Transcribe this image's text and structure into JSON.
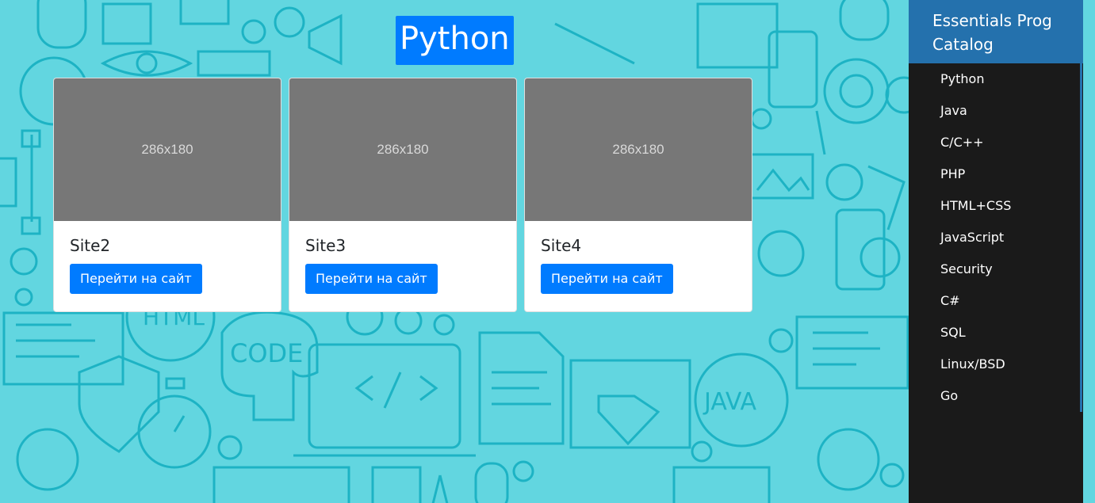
{
  "header": {
    "title": "Python"
  },
  "cards": [
    {
      "image_text": "286x180",
      "title": "Site2",
      "button_label": "Перейти на сайт"
    },
    {
      "image_text": "286x180",
      "title": "Site3",
      "button_label": "Перейти на сайт"
    },
    {
      "image_text": "286x180",
      "title": "Site4",
      "button_label": "Перейти на сайт"
    }
  ],
  "sidebar": {
    "title": "Essentials Prog Catalog",
    "items": [
      {
        "label": "Python"
      },
      {
        "label": "Java"
      },
      {
        "label": "C/C++"
      },
      {
        "label": "PHP"
      },
      {
        "label": "HTML+CSS"
      },
      {
        "label": "JavaScript"
      },
      {
        "label": "Security"
      },
      {
        "label": "C#"
      },
      {
        "label": "SQL"
      },
      {
        "label": "Linux/BSD"
      },
      {
        "label": "Go"
      }
    ]
  },
  "background": {
    "labels": {
      "html": "HTML",
      "code": "CODE",
      "java": "JAVA"
    }
  },
  "colors": {
    "background": "#62d6e0",
    "pattern_stroke": "#1db3c4",
    "accent": "#007bff",
    "sidebar_header": "#2471ad",
    "sidebar_bg": "#1a1a1a",
    "card_placeholder": "#777777"
  }
}
